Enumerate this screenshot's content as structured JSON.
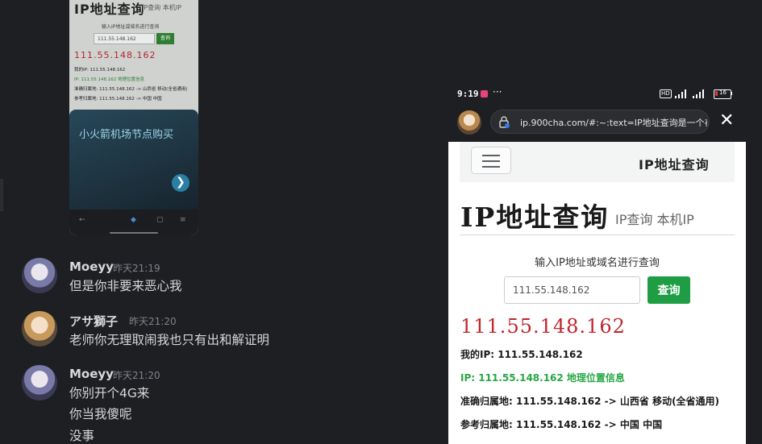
{
  "thumbnail": {
    "title": "IP地址查询",
    "subtitle": "IP查询 本机IP",
    "prompt": "输入IP地址或域名进行查询",
    "input_value": "111.55.148.162",
    "button": "查询",
    "ip": "111.55.148.162",
    "lines": [
      "我的IP: 111.55.148.162",
      "IP: 111.55.148.162 地理位置信息",
      "准确归属地: 111.55.148.162 -> 山西省 移动(全省通用)",
      "参考归属地: 111.55.148.162 -> 中国 中国"
    ],
    "ad_title": "小火箭机场节点购买",
    "ad_arrow": "❯"
  },
  "messages": [
    {
      "author": "Moeyy",
      "time": "昨天21:19",
      "lines": [
        "但是你非要来恶心我"
      ]
    },
    {
      "author": "アサ獅子",
      "time": "昨天21:20",
      "lines": [
        "老师你无理取闹我也只有出和解证明"
      ]
    },
    {
      "author": "Moeyy",
      "time": "昨天21:20",
      "lines": [
        "你别开个4G来",
        "你当我傻呢",
        "没事"
      ]
    }
  ],
  "phone": {
    "status": {
      "time": "9:19",
      "more": "···",
      "hd": "HD",
      "battery": "16"
    },
    "browser": {
      "url": "ip.900cha.com/#:~:text=IP地址查询是一个在",
      "close": "✕"
    },
    "brand": "IP地址查询",
    "title": "IP地址查询",
    "title_sub": "IP查询 本机IP",
    "prompt": "输入IP地址或域名进行查询",
    "input_value": "111.55.148.162",
    "button": "查询",
    "ip": "111.55.148.162",
    "my_ip": "我的IP: 111.55.148.162",
    "geo_header": "IP: 111.55.148.162 地理位置信息",
    "accurate": "准确归属地: 111.55.148.162 -> 山西省 移动(全省通用)",
    "reference": "参考归属地: 111.55.148.162 -> 中国 中国"
  }
}
